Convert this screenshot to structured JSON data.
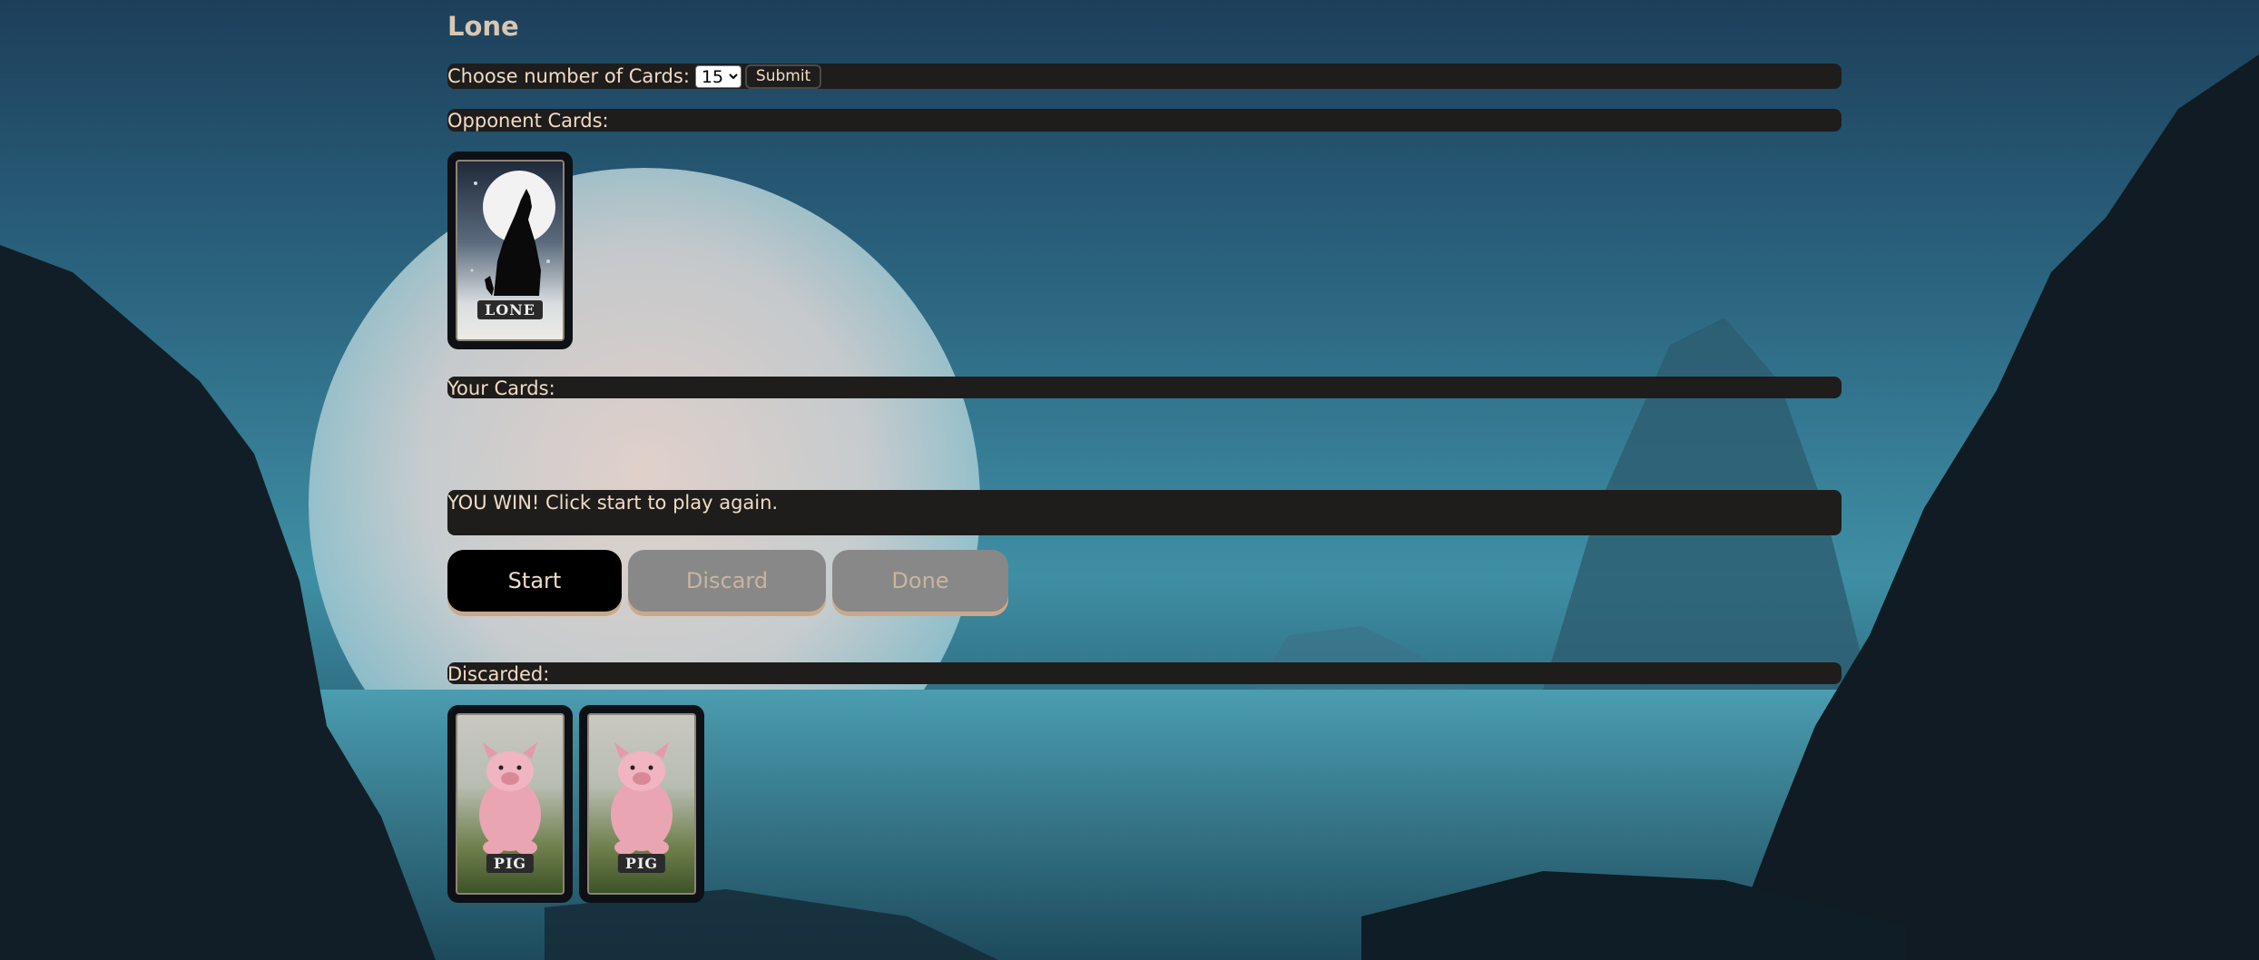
{
  "app": {
    "title": "Lone"
  },
  "controls": {
    "choose_label": "Choose number of Cards:",
    "selected_count": "15",
    "submit_label": "Submit"
  },
  "opponent": {
    "label": "Opponent Cards:",
    "cards": [
      {
        "name": "LONE",
        "icon": "wolf-icon"
      }
    ]
  },
  "player": {
    "label": "Your Cards:",
    "cards": []
  },
  "status": {
    "message": "YOU WIN! Click start to play again."
  },
  "buttons": {
    "start": "Start",
    "discard": "Discard",
    "done": "Done"
  },
  "discarded": {
    "label": "Discarded:",
    "cards": [
      {
        "name": "PIG",
        "icon": "pig-icon"
      },
      {
        "name": "PIG",
        "icon": "pig-icon"
      }
    ]
  },
  "colors": {
    "accent": "#f1dcc4",
    "bar": "#1e1d1c",
    "disabled": "#888888"
  }
}
